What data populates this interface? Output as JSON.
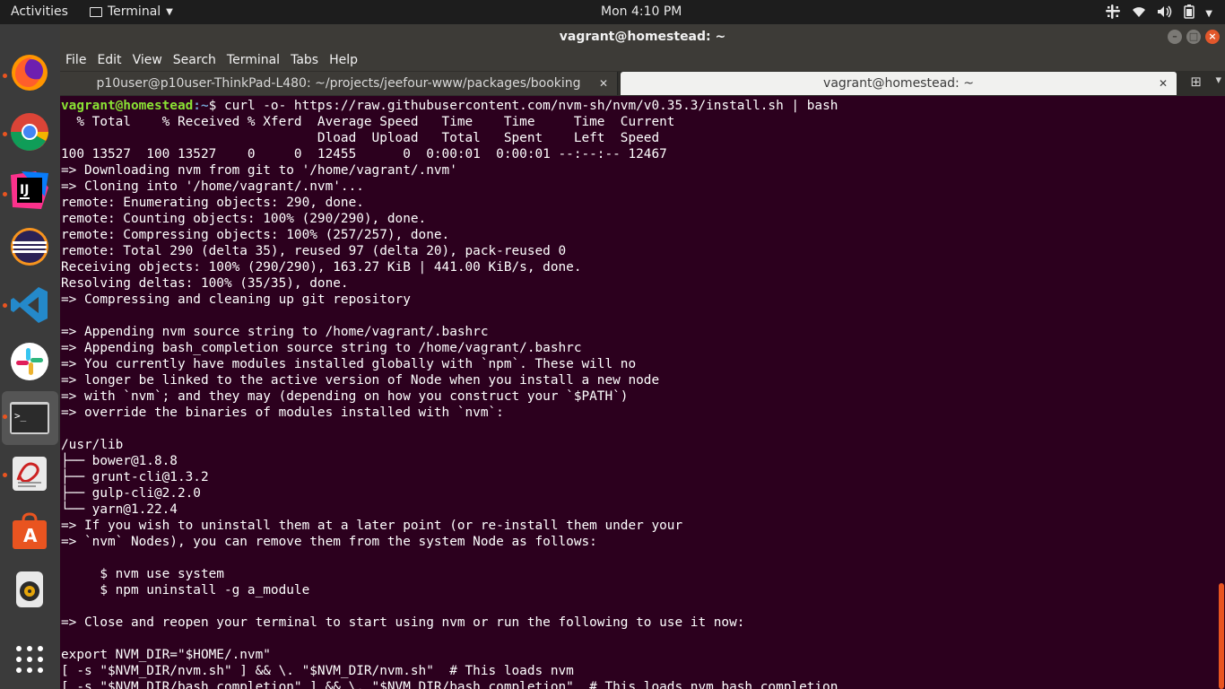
{
  "topbar": {
    "activities": "Activities",
    "app_name": "Terminal",
    "clock": "Mon  4:10 PM"
  },
  "window": {
    "title": "vagrant@homestead: ~"
  },
  "menu": [
    "File",
    "Edit",
    "View",
    "Search",
    "Terminal",
    "Tabs",
    "Help"
  ],
  "tabs": [
    {
      "label": "p10user@p10user-ThinkPad-L480: ~/projects/jeefour-www/packages/booking",
      "active": false
    },
    {
      "label": "vagrant@homestead: ~",
      "active": true
    }
  ],
  "dock": {
    "items": [
      "firefox",
      "chrome",
      "intellij",
      "eclipse",
      "vscode",
      "slack",
      "terminal",
      "document-viewer",
      "software-center",
      "rhythmbox",
      "show-apps"
    ],
    "colors": {
      "accent": "#e95420",
      "dock_bg": "#3b3b3b"
    }
  },
  "terminal": {
    "prompt_user": "vagrant@homestead",
    "prompt_path": ":~",
    "prompt_symbol": "$ ",
    "command": "curl -o- https://raw.githubusercontent.com/nvm-sh/nvm/v0.35.3/install.sh | bash",
    "output": "  % Total    % Received % Xferd  Average Speed   Time    Time     Time  Current\n                                 Dload  Upload   Total   Spent    Left  Speed\n100 13527  100 13527    0     0  12455      0  0:00:01  0:00:01 --:--:-- 12467\n=> Downloading nvm from git to '/home/vagrant/.nvm'\n=> Cloning into '/home/vagrant/.nvm'...\nremote: Enumerating objects: 290, done.\nremote: Counting objects: 100% (290/290), done.\nremote: Compressing objects: 100% (257/257), done.\nremote: Total 290 (delta 35), reused 97 (delta 20), pack-reused 0\nReceiving objects: 100% (290/290), 163.27 KiB | 441.00 KiB/s, done.\nResolving deltas: 100% (35/35), done.\n=> Compressing and cleaning up git repository\n\n=> Appending nvm source string to /home/vagrant/.bashrc\n=> Appending bash_completion source string to /home/vagrant/.bashrc\n=> You currently have modules installed globally with `npm`. These will no\n=> longer be linked to the active version of Node when you install a new node\n=> with `nvm`; and they may (depending on how you construct your `$PATH`)\n=> override the binaries of modules installed with `nvm`:\n\n/usr/lib\n├── bower@1.8.8\n├── grunt-cli@1.3.2\n├── gulp-cli@2.2.0\n└── yarn@1.22.4\n=> If you wish to uninstall them at a later point (or re-install them under your\n=> `nvm` Nodes), you can remove them from the system Node as follows:\n\n     $ nvm use system\n     $ npm uninstall -g a_module\n\n=> Close and reopen your terminal to start using nvm or run the following to use it now:\n\nexport NVM_DIR=\"$HOME/.nvm\"\n[ -s \"$NVM_DIR/nvm.sh\" ] && \\. \"$NVM_DIR/nvm.sh\"  # This loads nvm\n[ -s \"$NVM_DIR/bash_completion\" ] && \\. \"$NVM_DIR/bash_completion\"  # This loads nvm bash_completion"
  }
}
